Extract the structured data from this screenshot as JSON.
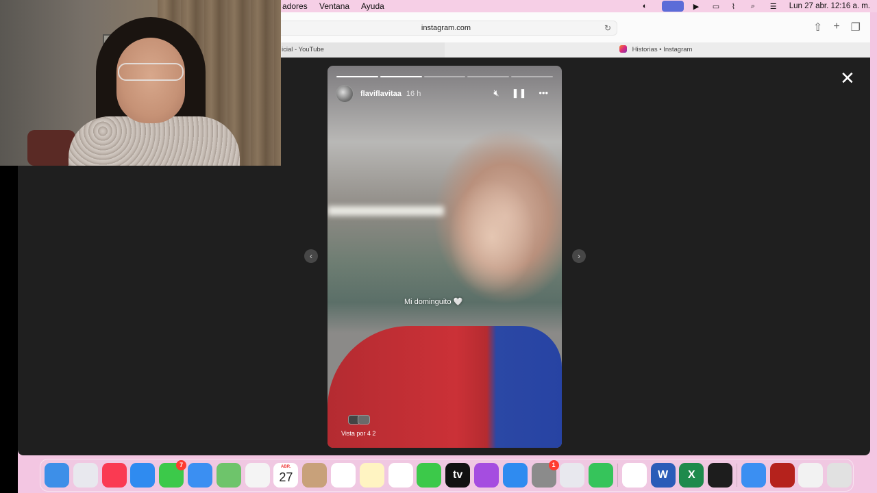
{
  "menubar": {
    "items": [
      "adores",
      "Ventana",
      "Ayuda"
    ],
    "clock": "Lun 27 abr.  12:16 a. m."
  },
  "browser": {
    "url": "instagram.com",
    "tabs": [
      {
        "label": "icial - YouTube"
      },
      {
        "label": "Historias • Instagram"
      }
    ]
  },
  "story": {
    "username": "flaviflavitaa",
    "time": "16 h",
    "caption": "Mi dominguito 🤍",
    "seen_by": "Vista por 4   2",
    "progress_segments": [
      1,
      1,
      0,
      0,
      0
    ],
    "colors": {
      "accent": "#ffffff",
      "overlay": "#1f1f1f"
    }
  },
  "dock": {
    "apps": [
      {
        "name": "finder",
        "color": "#3d8fe8"
      },
      {
        "name": "launchpad",
        "color": "#e8e8ee"
      },
      {
        "name": "music",
        "color": "#fa3a52"
      },
      {
        "name": "safari",
        "color": "#2f8bf0"
      },
      {
        "name": "messages",
        "color": "#3cc94a",
        "badge": "7"
      },
      {
        "name": "mail",
        "color": "#3b8ff2"
      },
      {
        "name": "maps",
        "color": "#6ec46b"
      },
      {
        "name": "photos",
        "color": "#f4f4f4"
      },
      {
        "name": "calendar",
        "color": "#ffffff",
        "month": "ABR.",
        "day": "27"
      },
      {
        "name": "contacts",
        "color": "#c8a17a"
      },
      {
        "name": "reminders",
        "color": "#ffffff"
      },
      {
        "name": "notes",
        "color": "#fff4c2"
      },
      {
        "name": "freeform",
        "color": "#ffffff"
      },
      {
        "name": "facetime",
        "color": "#3cc94a"
      },
      {
        "name": "tv",
        "color": "#111111",
        "label": "tv"
      },
      {
        "name": "podcasts",
        "color": "#a54de0"
      },
      {
        "name": "app-store",
        "color": "#2f8bf0"
      },
      {
        "name": "system-settings",
        "color": "#8b8b8b",
        "badge": "1"
      },
      {
        "name": "iphone-mirroring",
        "color": "#e8e8ee"
      },
      {
        "name": "whatsapp",
        "color": "#36c45b"
      },
      {
        "name": "chrome",
        "color": "#ffffff"
      },
      {
        "name": "word",
        "color": "#2b5cb8",
        "label": "W"
      },
      {
        "name": "excel",
        "color": "#1e8a4c",
        "label": "X"
      },
      {
        "name": "obs",
        "color": "#1d1d1d"
      },
      {
        "name": "network",
        "color": "#3b8ff2"
      },
      {
        "name": "photo-booth",
        "color": "#b5221c"
      },
      {
        "name": "document",
        "color": "#f2f2f2"
      },
      {
        "name": "trash",
        "color": "#e1e1e1"
      }
    ]
  }
}
